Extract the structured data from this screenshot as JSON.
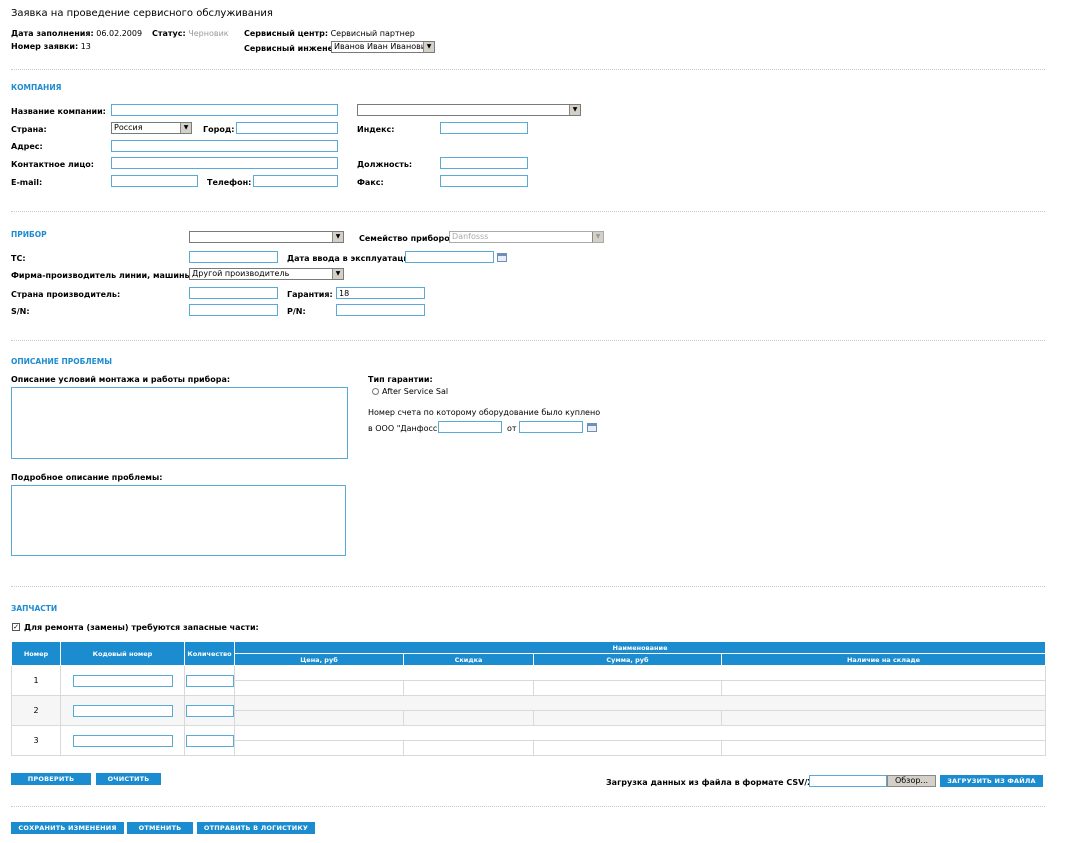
{
  "header": {
    "title": "Заявка на проведение сервисного обслуживания",
    "date_label": "Дата заполнения:",
    "date_value": "06.02.2009",
    "number_label": "Номер заявки:",
    "number_value": "13",
    "status_label": "Статус:",
    "status_value": "Черновик",
    "center_label": "Сервисный центр:",
    "center_value": "Сервисный партнер",
    "engineer_label": "Сервисный инженер:",
    "engineer_value": "Иванов Иван Иванович"
  },
  "company": {
    "section_title": "КОМПАНИЯ",
    "name_label": "Название компании:",
    "country_label": "Страна:",
    "country_value": "Россия",
    "city_label": "Город:",
    "index_label": "Индекс:",
    "address_label": "Адрес:",
    "contact_label": "Контактное лицо:",
    "position_label": "Должность:",
    "email_label": "E-mail:",
    "phone_label": "Телефон:",
    "fax_label": "Факс:"
  },
  "device": {
    "section_title": "ПРИБОР",
    "family_label": "Семейство приборов:",
    "family_value": "Danfosss",
    "tc_label": "ТС:",
    "date_label": "Дата ввода в эксплуатацию:",
    "manufacturer_label": "Фирма-производитель линии, машины:",
    "manufacturer_value": "Другой производитель",
    "country_label": "Страна производитель:",
    "warranty_label": "Гарантия:",
    "warranty_value": "18",
    "sn_label": "S/N:",
    "pn_label": "P/N:"
  },
  "problem": {
    "section_title": "ОПИСАНИЕ ПРОБЛЕМЫ",
    "conditions_label": "Описание условий монтажа и работы прибора:",
    "details_label": "Подробное описание проблемы:",
    "warranty_type_label": "Тип гарантии:",
    "warranty_option": "After Service Sal",
    "invoice_label_1": "Номер счета по которому оборудование было куплено",
    "invoice_label_2": "в ООО \"Данфосс\":",
    "from_label": "от"
  },
  "parts": {
    "section_title": "ЗАПЧАСТИ",
    "checkbox_label": "Для ремонта (замены) требуются запасные части:",
    "columns": {
      "number": "Номер",
      "code": "Кодовый номер",
      "qty": "Количество",
      "name": "Наименование",
      "price": "Цена, руб",
      "discount": "Скидка",
      "sum": "Сумма, руб",
      "stock": "Наличие на складе"
    },
    "rows": [
      "1",
      "2",
      "3"
    ],
    "check_button": "ПРОВЕРИТЬ",
    "clear_button": "ОЧИСТИТЬ",
    "upload_label": "Загрузка данных из файла в формате CSV/XML:",
    "browse_button": "Обзор...",
    "upload_button": "ЗАГРУЗИТЬ ИЗ ФАЙЛА"
  },
  "footer": {
    "save_button": "СОХРАНИТЬ ИЗМЕНЕНИЯ",
    "cancel_button": "ОТМЕНИТЬ",
    "send_button": "ОТПРАВИТЬ В ЛОГИСТИКУ"
  },
  "colors": {
    "accent": "#1a8ccf",
    "field_border": "#5aaad8"
  }
}
